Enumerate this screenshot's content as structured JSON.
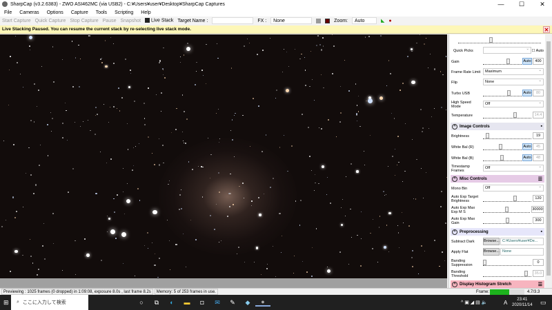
{
  "title": "SharpCap (v3.2.6383) - ZWO ASI462MC (via USB2) - C:¥Users¥user¥Desktop¥SharpCap Captures",
  "window_controls": [
    "—",
    "☐",
    "✕"
  ],
  "menu": [
    "File",
    "Cameras",
    "Options",
    "Capture",
    "Tools",
    "Scripting",
    "Help"
  ],
  "toolbar": {
    "start_capture": "Start Capture",
    "quick_capture": "Quick Capture",
    "stop_capture": "Stop Capture",
    "pause": "Pause",
    "snapshot": "Snapshot",
    "live_stack": "Live Stack",
    "target_name_label": "Target Name :",
    "target_name_value": "",
    "fx_label": "FX :",
    "fx_value": "None",
    "zoom_label": "Zoom:",
    "zoom_value": "Auto"
  },
  "notice": "Live Stacking Paused. You can resume the current stack by re-selecting live stack mode.",
  "panel": {
    "quick_picks": "Quick Picks",
    "auto": "Auto",
    "gain": {
      "label": "Gain",
      "value": "400",
      "auto": "Auto"
    },
    "frame_rate": {
      "label": "Frame Rate Limit",
      "value": "Maximum"
    },
    "flip": {
      "label": "Flip",
      "value": "None"
    },
    "turbo_usb": {
      "label": "Turbo USB",
      "value": "80",
      "auto": "Auto"
    },
    "high_speed": {
      "label": "High Speed Mode",
      "value": "Off"
    },
    "temperature": {
      "label": "Temperature",
      "value": "14.4"
    },
    "image_controls": "Image Controls",
    "brightness": {
      "label": "Brightness",
      "value": "19"
    },
    "wb_r": {
      "label": "White Bal (R)",
      "value": "45",
      "auto": "Auto"
    },
    "wb_b": {
      "label": "White Bal (B)",
      "value": "48",
      "auto": "Auto"
    },
    "timestamp": {
      "label": "Timestamp Frames",
      "value": "Off"
    },
    "misc_controls": "Misc Controls",
    "mono_bin": {
      "label": "Mono Bin",
      "value": "Off"
    },
    "ae_target": {
      "label": "Auto Exp Target Brightness",
      "value": "120"
    },
    "ae_max_exp": {
      "label": "Auto Exp Max Exp M S",
      "value": "30000"
    },
    "ae_max_gain": {
      "label": "Auto Exp Max Gain",
      "value": "300"
    },
    "preprocessing": "Preprocessing",
    "subtract_dark": {
      "label": "Subtract Dark",
      "button": "Browse...",
      "value": "C:¥Users¥user¥De..."
    },
    "apply_flat": {
      "label": "Apply Flat",
      "button": "Browse...",
      "value": "None"
    },
    "banding_supp": {
      "label": "Banding Suppression",
      "value": "0"
    },
    "banding_thresh": {
      "label": "Banding Threshold",
      "value": "35.0"
    },
    "histogram": "Display Histogram Stretch"
  },
  "colors": {
    "image_header": "#e6e6f0",
    "misc_header": "#e6cbe6",
    "pre_header": "#e6e6fa",
    "hist_header": "#f7b4bf",
    "frame_bar": "#1db31d"
  },
  "status": {
    "preview": "Previewing : 1025 frames (0 dropped) in 1:09:08, exposure 8.0s , last frame 8.2s",
    "memory": "Memory: 5 of 253 frames in use.",
    "frame_label": "Frame:",
    "frame_fill_pct": 55,
    "frame_value": "4.7/3.3"
  },
  "taskbar": {
    "search_placeholder": "ここに入力して検索",
    "time": "23:41",
    "date": "2020/11/14",
    "ime": "A"
  }
}
